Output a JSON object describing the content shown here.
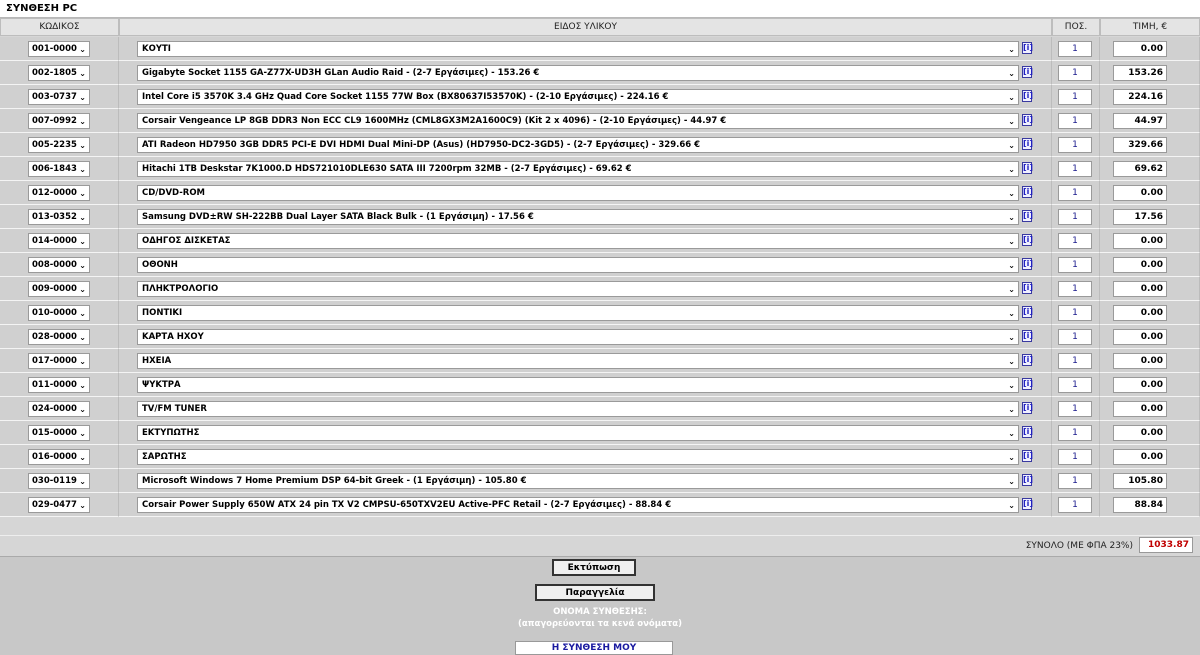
{
  "page": {
    "title": "ΣΥΝΘΕΣΗ PC"
  },
  "headers": {
    "code": "ΚΩΔΙΚΟΣ",
    "description": "ΕΙΔΟΣ ΥΛΙΚΟΥ",
    "qty": "ΠΟΣ.",
    "price": "ΤΙΜΗ, €"
  },
  "info_icon": "[i]",
  "dropdown_icon": "⌄",
  "rows": [
    {
      "code": "001-0000",
      "description": "ΚΟΥΤΙ",
      "qty": "1",
      "price": "0.00"
    },
    {
      "code": "002-1805",
      "description": "Gigabyte Socket 1155 GA-Z77X-UD3H GLan Audio Raid - (2-7 Εργάσιμες) - 153.26 €",
      "qty": "1",
      "price": "153.26"
    },
    {
      "code": "003-0737",
      "description": "Intel Core i5 3570K 3.4 GHz Quad Core Socket 1155 77W Box (BX80637I53570K) - (2-10 Εργάσιμες) - 224.16 €",
      "qty": "1",
      "price": "224.16"
    },
    {
      "code": "007-0992",
      "description": "Corsair Vengeance LP 8GB DDR3 Non ECC CL9 1600MHz (CML8GX3M2A1600C9) (Kit 2 x 4096) - (2-10 Εργάσιμες) - 44.97 €",
      "qty": "1",
      "price": "44.97"
    },
    {
      "code": "005-2235",
      "description": "ATI Radeon HD7950 3GB DDR5 PCI-E DVI HDMI Dual Mini-DP (Asus) (HD7950-DC2-3GD5) - (2-7 Εργάσιμες) - 329.66 €",
      "qty": "1",
      "price": "329.66"
    },
    {
      "code": "006-1843",
      "description": "Hitachi 1TB Deskstar 7K1000.D HDS721010DLE630 SATA III 7200rpm 32MB - (2-7 Εργάσιμες) - 69.62 €",
      "qty": "1",
      "price": "69.62"
    },
    {
      "code": "012-0000",
      "description": "CD/DVD-ROM",
      "qty": "1",
      "price": "0.00"
    },
    {
      "code": "013-0352",
      "description": "Samsung DVD±RW SH-222BB Dual Layer SATA Black Bulk - (1 Εργάσιμη) - 17.56 €",
      "qty": "1",
      "price": "17.56"
    },
    {
      "code": "014-0000",
      "description": "ΟΔΗΓΟΣ ΔΙΣΚΕΤΑΣ",
      "qty": "1",
      "price": "0.00"
    },
    {
      "code": "008-0000",
      "description": "ΟΘΟΝΗ",
      "qty": "1",
      "price": "0.00"
    },
    {
      "code": "009-0000",
      "description": "ΠΛΗΚΤΡΟΛΟΓΙΟ",
      "qty": "1",
      "price": "0.00"
    },
    {
      "code": "010-0000",
      "description": "ΠΟΝΤΙΚΙ",
      "qty": "1",
      "price": "0.00"
    },
    {
      "code": "028-0000",
      "description": "ΚΑΡΤΑ ΗΧΟΥ",
      "qty": "1",
      "price": "0.00"
    },
    {
      "code": "017-0000",
      "description": "ΗΧΕΙΑ",
      "qty": "1",
      "price": "0.00"
    },
    {
      "code": "011-0000",
      "description": "ΨΥΚΤΡΑ",
      "qty": "1",
      "price": "0.00"
    },
    {
      "code": "024-0000",
      "description": "TV/FM TUNER",
      "qty": "1",
      "price": "0.00"
    },
    {
      "code": "015-0000",
      "description": "ΕΚΤΥΠΩΤΗΣ",
      "qty": "1",
      "price": "0.00"
    },
    {
      "code": "016-0000",
      "description": "ΣΑΡΩΤΗΣ",
      "qty": "1",
      "price": "0.00"
    },
    {
      "code": "030-0119",
      "description": "Microsoft Windows 7 Home Premium DSP 64-bit Greek - (1 Εργάσιμη) - 105.80 €",
      "qty": "1",
      "price": "105.80"
    },
    {
      "code": "029-0477",
      "description": "Corsair Power Supply 650W ATX 24 pin TX V2 CMPSU-650TXV2EU Active-PFC Retail - (2-7 Εργάσιμες) - 88.84 €",
      "qty": "1",
      "price": "88.84"
    }
  ],
  "summary": {
    "label": "ΣΥΝΟΛΟ (ΜΕ ΦΠΑ 23%)",
    "total": "1033.87"
  },
  "buttons": {
    "print": "Εκτύπωση",
    "order": "Παραγγελία"
  },
  "name": {
    "label": "ΟΝΟΜΑ ΣΥΝΘΕΣΗΣ:",
    "hint": "(απαγορεύονται τα κενά ονόματα)",
    "value": "Η ΣΥΝΘΕΣΗ ΜΟΥ"
  }
}
